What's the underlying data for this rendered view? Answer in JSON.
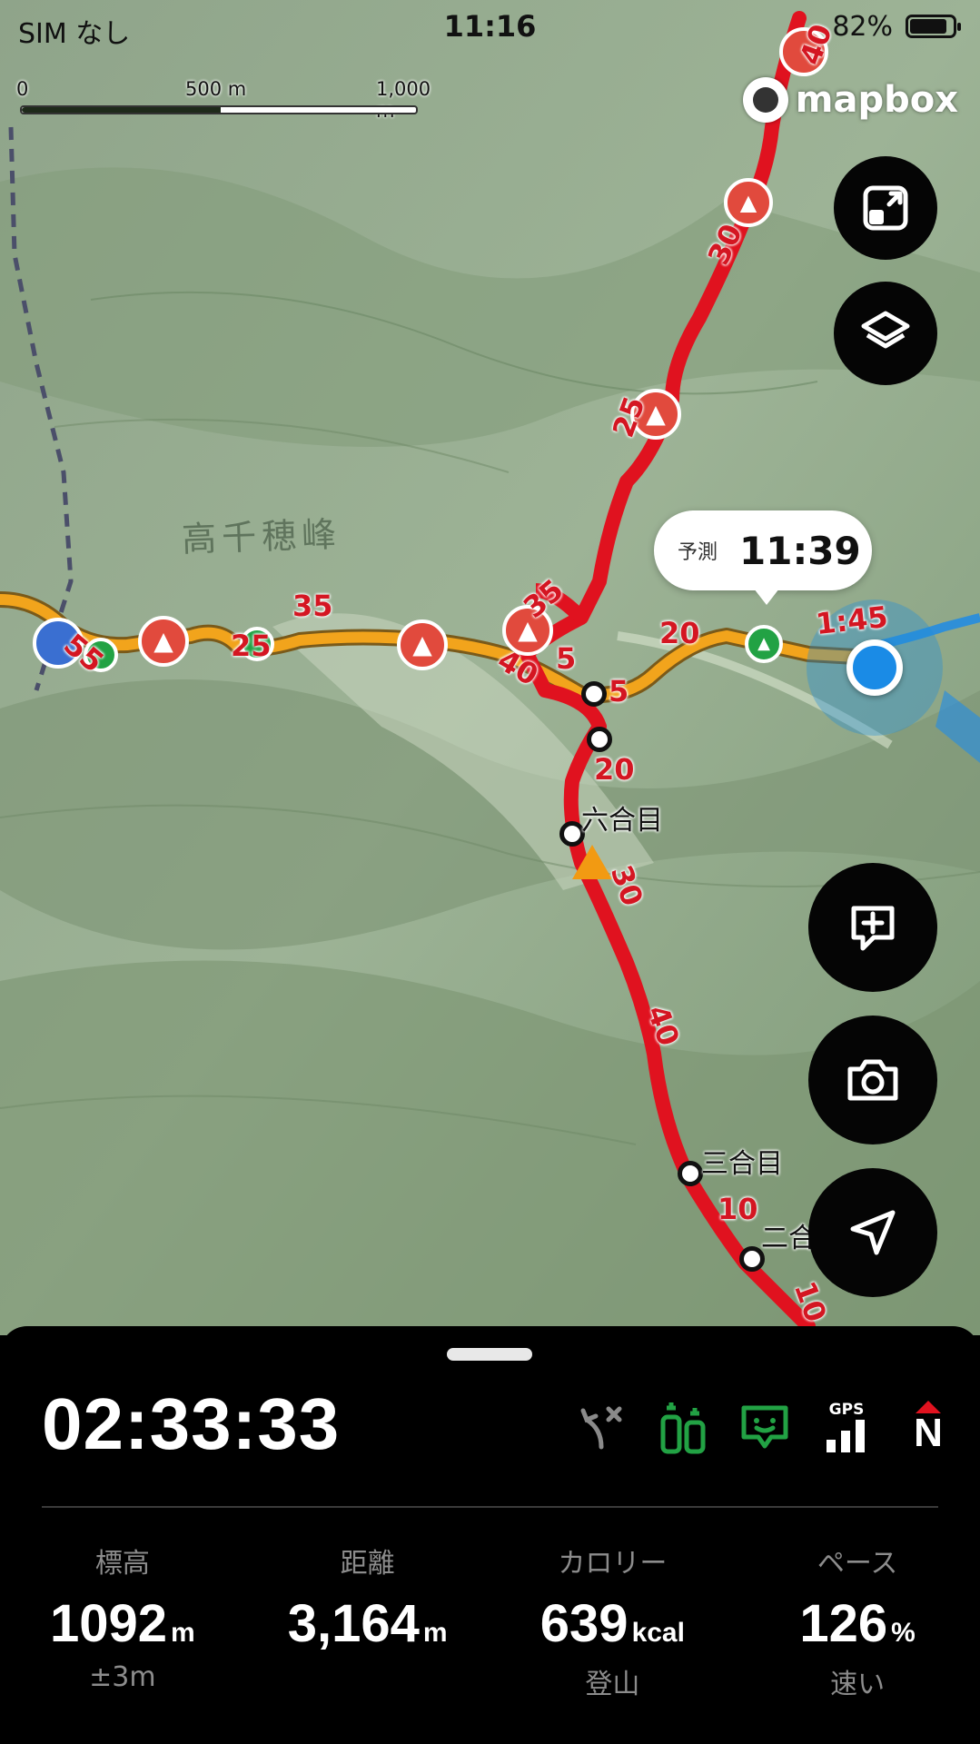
{
  "status_bar": {
    "carrier": "SIM なし",
    "time": "11:16",
    "battery": "82%"
  },
  "map": {
    "scale": {
      "labels": [
        "0",
        "500 m",
        "1,000 m"
      ]
    },
    "attribution": "mapbox",
    "peak_name": "高千穂峰",
    "prediction": {
      "label": "予測",
      "time": "11:39"
    },
    "route_labels": [
      "40",
      "30",
      "25",
      "35",
      "35",
      "5",
      "40",
      "5",
      "20",
      "20",
      "1:45",
      "25",
      "55",
      "30",
      "40",
      "10",
      "10"
    ],
    "places": [
      "六合目",
      "三合目",
      "二合"
    ],
    "colors": {
      "route": "#e0121f",
      "trail": "#f2a41c",
      "water": "#2f8fd8",
      "location": "#1a8be6"
    }
  },
  "controls": {
    "fit_icon": "fit-route-icon",
    "layers_icon": "layers-icon",
    "memo_icon": "add-memo-icon",
    "camera_icon": "camera-icon",
    "navigate_icon": "navigate-icon"
  },
  "panel": {
    "elapsed": "02:33:33",
    "status_icons": [
      "off-route-icon",
      "checkpoint-icon",
      "companion-icon",
      "gps-signal-icon",
      "compass-icon"
    ],
    "gps_label": "GPS",
    "compass_label": "N",
    "stats": [
      {
        "label": "標高",
        "value": "1092",
        "unit": "m",
        "sub": "±3m"
      },
      {
        "label": "距離",
        "value": "3,164",
        "unit": "m",
        "sub": ""
      },
      {
        "label": "カロリー",
        "value": "639",
        "unit": "kcal",
        "sub": "登山"
      },
      {
        "label": "ペース",
        "value": "126",
        "unit": "%",
        "sub": "速い"
      }
    ]
  }
}
